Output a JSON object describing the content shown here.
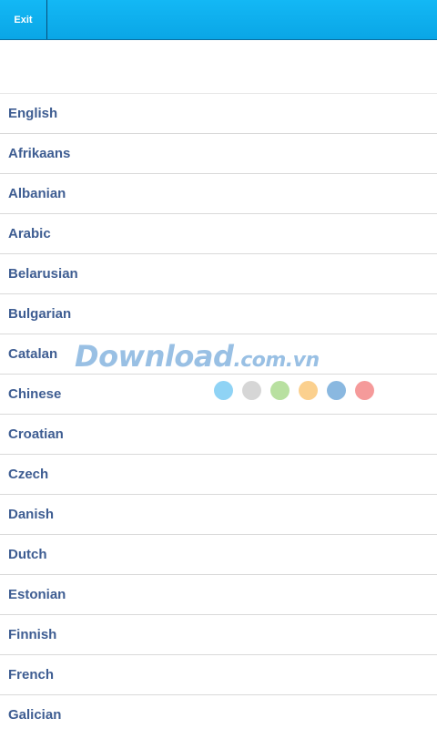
{
  "header": {
    "exit_label": "Exit"
  },
  "languages": [
    "English",
    "Afrikaans",
    "Albanian",
    "Arabic",
    "Belarusian",
    "Bulgarian",
    "Catalan",
    "Chinese",
    "Croatian",
    "Czech",
    "Danish",
    "Dutch",
    "Estonian",
    "Finnish",
    "French",
    "Galician"
  ],
  "watermark": {
    "main": "Download",
    "suffix": ".com.vn",
    "dot_colors": [
      "#8fd3f5",
      "#d6d6d6",
      "#b8e0a0",
      "#fbd08e",
      "#8ab8e0",
      "#f59a9a"
    ]
  },
  "colors": {
    "header": "#0aa6e6",
    "item_text": "#3e5d92"
  }
}
